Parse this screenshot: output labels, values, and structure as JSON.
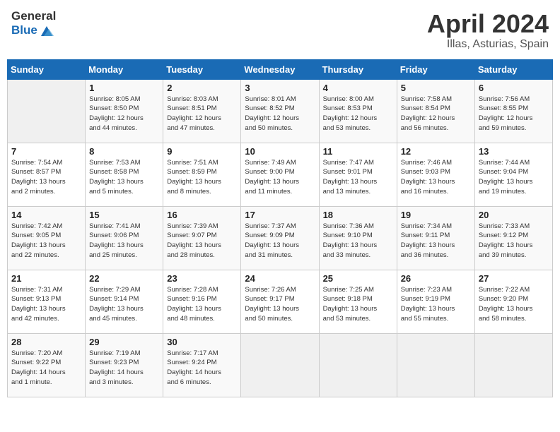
{
  "header": {
    "logo_general": "General",
    "logo_blue": "Blue",
    "title": "April 2024",
    "subtitle": "Illas, Asturias, Spain"
  },
  "weekdays": [
    "Sunday",
    "Monday",
    "Tuesday",
    "Wednesday",
    "Thursday",
    "Friday",
    "Saturday"
  ],
  "weeks": [
    [
      {
        "day": "",
        "info": ""
      },
      {
        "day": "1",
        "info": "Sunrise: 8:05 AM\nSunset: 8:50 PM\nDaylight: 12 hours\nand 44 minutes."
      },
      {
        "day": "2",
        "info": "Sunrise: 8:03 AM\nSunset: 8:51 PM\nDaylight: 12 hours\nand 47 minutes."
      },
      {
        "day": "3",
        "info": "Sunrise: 8:01 AM\nSunset: 8:52 PM\nDaylight: 12 hours\nand 50 minutes."
      },
      {
        "day": "4",
        "info": "Sunrise: 8:00 AM\nSunset: 8:53 PM\nDaylight: 12 hours\nand 53 minutes."
      },
      {
        "day": "5",
        "info": "Sunrise: 7:58 AM\nSunset: 8:54 PM\nDaylight: 12 hours\nand 56 minutes."
      },
      {
        "day": "6",
        "info": "Sunrise: 7:56 AM\nSunset: 8:55 PM\nDaylight: 12 hours\nand 59 minutes."
      }
    ],
    [
      {
        "day": "7",
        "info": "Sunrise: 7:54 AM\nSunset: 8:57 PM\nDaylight: 13 hours\nand 2 minutes."
      },
      {
        "day": "8",
        "info": "Sunrise: 7:53 AM\nSunset: 8:58 PM\nDaylight: 13 hours\nand 5 minutes."
      },
      {
        "day": "9",
        "info": "Sunrise: 7:51 AM\nSunset: 8:59 PM\nDaylight: 13 hours\nand 8 minutes."
      },
      {
        "day": "10",
        "info": "Sunrise: 7:49 AM\nSunset: 9:00 PM\nDaylight: 13 hours\nand 11 minutes."
      },
      {
        "day": "11",
        "info": "Sunrise: 7:47 AM\nSunset: 9:01 PM\nDaylight: 13 hours\nand 13 minutes."
      },
      {
        "day": "12",
        "info": "Sunrise: 7:46 AM\nSunset: 9:03 PM\nDaylight: 13 hours\nand 16 minutes."
      },
      {
        "day": "13",
        "info": "Sunrise: 7:44 AM\nSunset: 9:04 PM\nDaylight: 13 hours\nand 19 minutes."
      }
    ],
    [
      {
        "day": "14",
        "info": "Sunrise: 7:42 AM\nSunset: 9:05 PM\nDaylight: 13 hours\nand 22 minutes."
      },
      {
        "day": "15",
        "info": "Sunrise: 7:41 AM\nSunset: 9:06 PM\nDaylight: 13 hours\nand 25 minutes."
      },
      {
        "day": "16",
        "info": "Sunrise: 7:39 AM\nSunset: 9:07 PM\nDaylight: 13 hours\nand 28 minutes."
      },
      {
        "day": "17",
        "info": "Sunrise: 7:37 AM\nSunset: 9:09 PM\nDaylight: 13 hours\nand 31 minutes."
      },
      {
        "day": "18",
        "info": "Sunrise: 7:36 AM\nSunset: 9:10 PM\nDaylight: 13 hours\nand 33 minutes."
      },
      {
        "day": "19",
        "info": "Sunrise: 7:34 AM\nSunset: 9:11 PM\nDaylight: 13 hours\nand 36 minutes."
      },
      {
        "day": "20",
        "info": "Sunrise: 7:33 AM\nSunset: 9:12 PM\nDaylight: 13 hours\nand 39 minutes."
      }
    ],
    [
      {
        "day": "21",
        "info": "Sunrise: 7:31 AM\nSunset: 9:13 PM\nDaylight: 13 hours\nand 42 minutes."
      },
      {
        "day": "22",
        "info": "Sunrise: 7:29 AM\nSunset: 9:14 PM\nDaylight: 13 hours\nand 45 minutes."
      },
      {
        "day": "23",
        "info": "Sunrise: 7:28 AM\nSunset: 9:16 PM\nDaylight: 13 hours\nand 48 minutes."
      },
      {
        "day": "24",
        "info": "Sunrise: 7:26 AM\nSunset: 9:17 PM\nDaylight: 13 hours\nand 50 minutes."
      },
      {
        "day": "25",
        "info": "Sunrise: 7:25 AM\nSunset: 9:18 PM\nDaylight: 13 hours\nand 53 minutes."
      },
      {
        "day": "26",
        "info": "Sunrise: 7:23 AM\nSunset: 9:19 PM\nDaylight: 13 hours\nand 55 minutes."
      },
      {
        "day": "27",
        "info": "Sunrise: 7:22 AM\nSunset: 9:20 PM\nDaylight: 13 hours\nand 58 minutes."
      }
    ],
    [
      {
        "day": "28",
        "info": "Sunrise: 7:20 AM\nSunset: 9:22 PM\nDaylight: 14 hours\nand 1 minute."
      },
      {
        "day": "29",
        "info": "Sunrise: 7:19 AM\nSunset: 9:23 PM\nDaylight: 14 hours\nand 3 minutes."
      },
      {
        "day": "30",
        "info": "Sunrise: 7:17 AM\nSunset: 9:24 PM\nDaylight: 14 hours\nand 6 minutes."
      },
      {
        "day": "",
        "info": ""
      },
      {
        "day": "",
        "info": ""
      },
      {
        "day": "",
        "info": ""
      },
      {
        "day": "",
        "info": ""
      }
    ]
  ]
}
